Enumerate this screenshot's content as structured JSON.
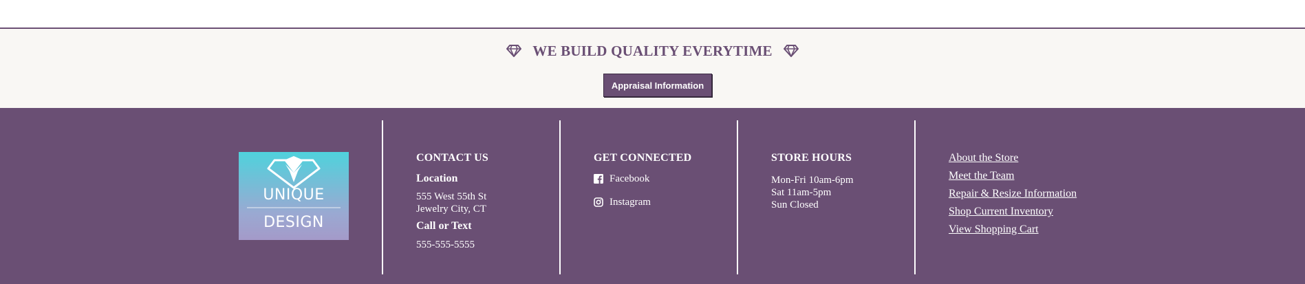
{
  "banner": {
    "tagline": "WE BUILD QUALITY EVERYTIME",
    "button_label": "Appraisal Information"
  },
  "logo": {
    "line1": "UNIQUE",
    "line2": "DESIGN"
  },
  "contact": {
    "heading": "CONTACT US",
    "location_label": "Location",
    "address_line1": "555 West 55th St",
    "address_line2": "Jewelry City, CT",
    "call_label": "Call or Text",
    "phone": "555-555-5555"
  },
  "social": {
    "heading": "GET CONNECTED",
    "items": [
      {
        "label": "Facebook",
        "icon": "facebook-icon"
      },
      {
        "label": "Instagram",
        "icon": "instagram-icon"
      }
    ]
  },
  "hours": {
    "heading": "STORE HOURS",
    "lines": [
      "Mon-Fri 10am-6pm",
      "Sat 11am-5pm",
      "Sun Closed"
    ]
  },
  "links": [
    "About the Store",
    "Meet the Team",
    "Repair & Resize Information",
    "Shop Current Inventory",
    "View Shopping Cart"
  ],
  "colors": {
    "brand_purple": "#6a4f74",
    "banner_bg": "#f9f7f4",
    "logo_gradient_top": "#4fd2dc",
    "logo_gradient_bottom": "#a49ac9"
  }
}
